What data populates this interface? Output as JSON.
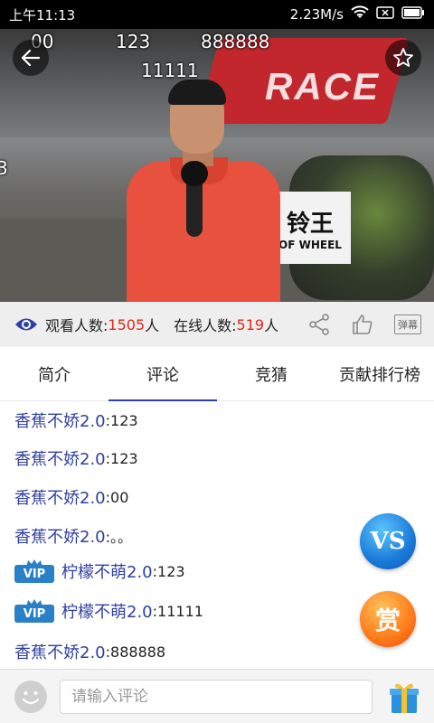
{
  "status_bar": {
    "time": "上午11:13",
    "network_speed": "2.23M/s"
  },
  "video": {
    "overlay_texts": [
      "00",
      "123",
      "888888",
      "11111",
      "3"
    ],
    "banner_text": "RACE",
    "sign_text_big": "铃王",
    "sign_text_small": "OF WHEEL"
  },
  "stats": {
    "viewers_label": "观看人数:",
    "viewers_count": "1505",
    "viewers_unit": "人",
    "online_label": "在线人数:",
    "online_count": "519",
    "online_unit": "人",
    "danmu_label": "弹幕"
  },
  "tabs": [
    {
      "label": "简介",
      "active": false
    },
    {
      "label": "评论",
      "active": true
    },
    {
      "label": "竞猜",
      "active": false
    },
    {
      "label": "贡献排行榜",
      "active": false
    }
  ],
  "comments": [
    {
      "user": "香蕉不娇2.0",
      "text": ":123",
      "vip": false
    },
    {
      "user": "香蕉不娇2.0",
      "text": ":123",
      "vip": false
    },
    {
      "user": "香蕉不娇2.0",
      "text": ":00",
      "vip": false
    },
    {
      "user": "香蕉不娇2.0",
      "text": ":。。",
      "vip": false
    },
    {
      "user": "柠檬不萌2.0",
      "text": ":123",
      "vip": true
    },
    {
      "user": "柠檬不萌2.0",
      "text": ":11111",
      "vip": true
    },
    {
      "user": "香蕉不娇2.0",
      "text": ":888888",
      "vip": false
    }
  ],
  "vip_label": "VIP",
  "floating": {
    "vs_label": "VS",
    "reward_label": "赏"
  },
  "input": {
    "placeholder": "请输入评论"
  },
  "colors": {
    "accent": "#2f3fa8",
    "count_red": "#e0281a",
    "username_blue": "#2f3f9f"
  }
}
